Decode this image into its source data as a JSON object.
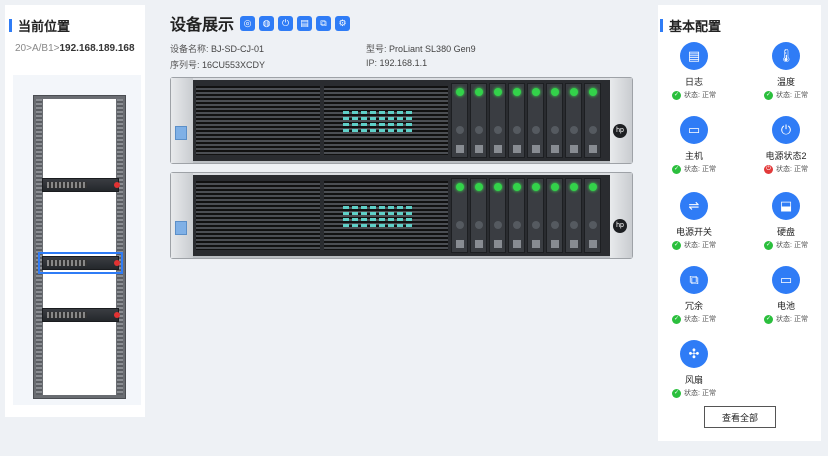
{
  "left": {
    "title": "当前位置",
    "breadcrumb_prefix": "20>A/B1>",
    "breadcrumb_current": "192.168.189.168"
  },
  "center": {
    "title": "设备展示",
    "toolbar_icons": [
      "cpu-icon",
      "globe-icon",
      "power-icon",
      "log-icon",
      "network-icon",
      "settings-icon"
    ],
    "device_name_label": "设备名称:",
    "device_name": "BJ-SD-CJ-01",
    "serial_label": "序列号:",
    "serial": "16CU553XCDY",
    "model_label": "型号:",
    "model": "ProLiant SL380 Gen9",
    "ip_label": "IP:",
    "ip": "192.168.1.1"
  },
  "right": {
    "title": "基本配置",
    "status_label": "状态:",
    "items": [
      {
        "name": "日志",
        "status": "正常",
        "icon": "log-icon",
        "ok": true
      },
      {
        "name": "温度",
        "status": "正常",
        "icon": "thermometer-icon",
        "ok": true
      },
      {
        "name": "主机",
        "status": "正常",
        "icon": "monitor-icon",
        "ok": true
      },
      {
        "name": "电源状态2",
        "status": "正常",
        "icon": "power-icon",
        "ok": false
      },
      {
        "name": "电源开关",
        "status": "正常",
        "icon": "toggle-icon",
        "ok": true
      },
      {
        "name": "硬盘",
        "status": "正常",
        "icon": "disk-icon",
        "ok": true
      },
      {
        "name": "冗余",
        "status": "正常",
        "icon": "network-icon",
        "ok": true
      },
      {
        "name": "电池",
        "status": "正常",
        "icon": "battery-icon",
        "ok": true
      },
      {
        "name": "风扇",
        "status": "正常",
        "icon": "fan-icon",
        "ok": true
      }
    ],
    "view_all": "查看全部"
  },
  "colors": {
    "accent": "#2f7cf6",
    "ok": "#2bbf3d",
    "error": "#e23a3a"
  }
}
